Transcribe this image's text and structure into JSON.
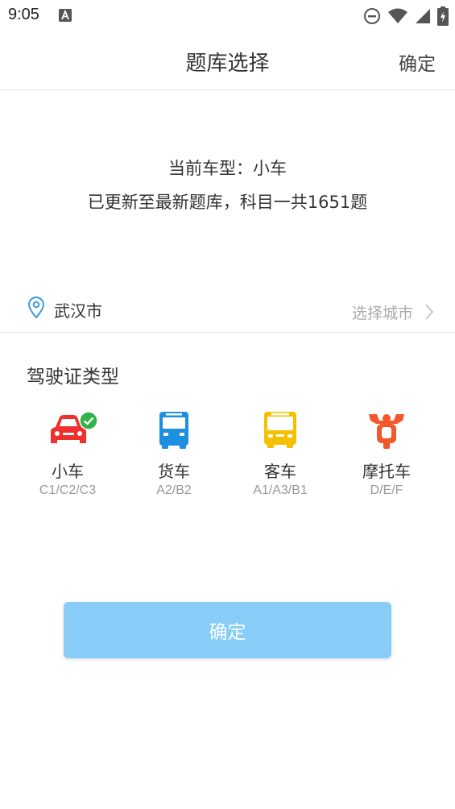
{
  "status_bar": {
    "time": "9:05",
    "icons": [
      "notification-a-icon",
      "do-not-disturb-icon",
      "wifi-icon",
      "signal-icon",
      "battery-icon"
    ]
  },
  "header": {
    "title": "题库选择",
    "confirm_label": "确定"
  },
  "info": {
    "current_type": "当前车型：小车",
    "update_text": "已更新至最新题库，科目一共1651题"
  },
  "city": {
    "name": "武汉市",
    "select_label": "选择城市",
    "icon": "location-pin-icon"
  },
  "license": {
    "title": "驾驶证类型",
    "selected_index": 0,
    "items": [
      {
        "name": "小车",
        "code": "C1/C2/C3",
        "icon": "car-icon",
        "color": "#f0302e"
      },
      {
        "name": "货车",
        "code": "A2/B2",
        "icon": "truck-icon",
        "color": "#1e8fe0"
      },
      {
        "name": "客车",
        "code": "A1/A3/B1",
        "icon": "bus-icon",
        "color": "#f5c000"
      },
      {
        "name": "摩托车",
        "code": "D/E/F",
        "icon": "motorcycle-icon",
        "color": "#f4572a"
      }
    ]
  },
  "colors": {
    "button": "#87cdf8",
    "check": "#2fb24a",
    "location": "#3b9be0"
  },
  "confirm_button": {
    "label": "确定"
  }
}
